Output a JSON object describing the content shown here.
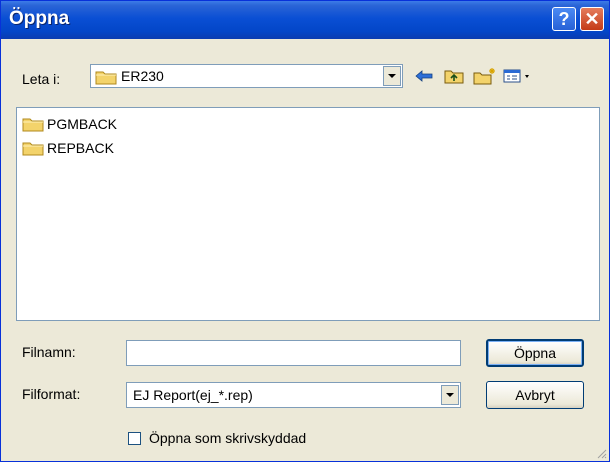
{
  "window": {
    "title": "Öppna"
  },
  "titlebar": {
    "help_glyph": "?",
    "close_glyph": "✕"
  },
  "lookin": {
    "label": "Leta i:",
    "value": "ER230",
    "icon": "folder-icon"
  },
  "toolbar": {
    "back_icon": "back-arrow-icon",
    "up_icon": "up-folder-icon",
    "new_folder_icon": "new-folder-icon",
    "view_icon": "view-menu-icon"
  },
  "files": [
    {
      "name": "PGMBACK",
      "icon": "folder-icon"
    },
    {
      "name": "REPBACK",
      "icon": "folder-icon"
    }
  ],
  "filename": {
    "label": "Filnamn:",
    "value": ""
  },
  "fileformat": {
    "label": "Filformat:",
    "value": "EJ Report(ej_*.rep)"
  },
  "buttons": {
    "open": "Öppna",
    "cancel": "Avbryt"
  },
  "readonly_checkbox": {
    "label": "Öppna som skrivskyddad",
    "checked": false
  },
  "colors": {
    "titlebar": "#0a4fd4",
    "dialog_bg": "#ece9d8",
    "folder": "#f3d36b"
  }
}
